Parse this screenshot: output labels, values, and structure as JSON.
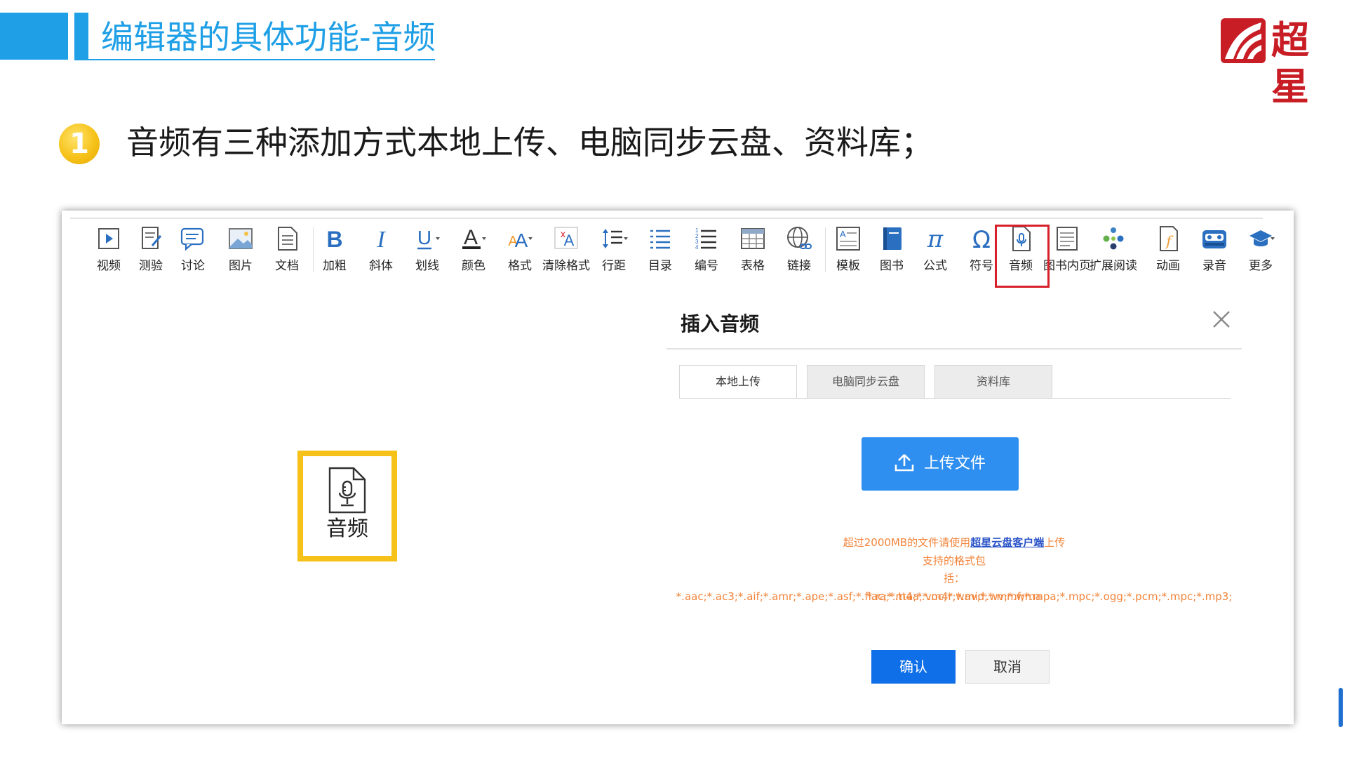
{
  "header": {
    "title": "编辑器的具体功能-音频",
    "logo_text": "超星"
  },
  "bullet": {
    "number": "1",
    "text": "音频有三种添加方式本地上传、电脑同步云盘、资料库；"
  },
  "toolbar": {
    "items": [
      {
        "label": "视频",
        "icon": "video-icon"
      },
      {
        "label": "测验",
        "icon": "quiz-icon"
      },
      {
        "label": "讨论",
        "icon": "discussion-icon"
      },
      {
        "label": "图片",
        "icon": "image-icon"
      },
      {
        "label": "文档",
        "icon": "document-icon"
      },
      {
        "label": "加粗",
        "icon": "bold-icon"
      },
      {
        "label": "斜体",
        "icon": "italic-icon"
      },
      {
        "label": "划线",
        "icon": "underline-icon"
      },
      {
        "label": "颜色",
        "icon": "font-color-icon"
      },
      {
        "label": "格式",
        "icon": "format-icon"
      },
      {
        "label": "清除格式",
        "icon": "clear-format-icon"
      },
      {
        "label": "行距",
        "icon": "line-spacing-icon"
      },
      {
        "label": "目录",
        "icon": "toc-icon"
      },
      {
        "label": "编号",
        "icon": "numbered-list-icon"
      },
      {
        "label": "表格",
        "icon": "table-icon"
      },
      {
        "label": "链接",
        "icon": "link-icon"
      },
      {
        "label": "模板",
        "icon": "template-icon"
      },
      {
        "label": "图书",
        "icon": "book-icon"
      },
      {
        "label": "公式",
        "icon": "formula-icon"
      },
      {
        "label": "符号",
        "icon": "symbol-icon"
      },
      {
        "label": "音频",
        "icon": "audio-icon"
      },
      {
        "label": "图书内页",
        "icon": "book-page-icon"
      },
      {
        "label": "扩展阅读",
        "icon": "extended-reading-icon"
      },
      {
        "label": "动画",
        "icon": "animation-icon"
      },
      {
        "label": "录音",
        "icon": "recording-icon"
      },
      {
        "label": "更多",
        "icon": "more-icon"
      }
    ]
  },
  "big_audio": {
    "label": "音频",
    "icon": "audio-file-icon"
  },
  "dialog": {
    "title": "插入音频",
    "tabs": [
      {
        "label": "本地上传",
        "active": true
      },
      {
        "label": "电脑同步云盘",
        "active": false
      },
      {
        "label": "资料库",
        "active": false
      }
    ],
    "upload_label": "上传文件",
    "hint_prefix": "超过2000MB的文件请使用",
    "hint_link": "超星云盘客户端",
    "hint_suffix": "上传",
    "formats_title": "支持的格式包",
    "formats_line1": "括：*.aac;*.ac3;*.aif;*.amr;*.ape;*.asf;*.flac;*.m4a;*.m4r;*.mid;*.mmf;*.mpa;*.mpc;*.ogg;*.pcm;*.mpc;*.mp3;",
    "formats_line2": "*.ra;*.tta;*.voc;*.wav;*.wv;*.wma",
    "confirm_label": "确认",
    "cancel_label": "取消"
  },
  "colors": {
    "accent_blue": "#1e9fe6",
    "highlight_red": "#d7202a",
    "highlight_yellow": "#f6c21a",
    "upload_blue": "#2f8ff0",
    "hint_orange": "#f2843a"
  }
}
